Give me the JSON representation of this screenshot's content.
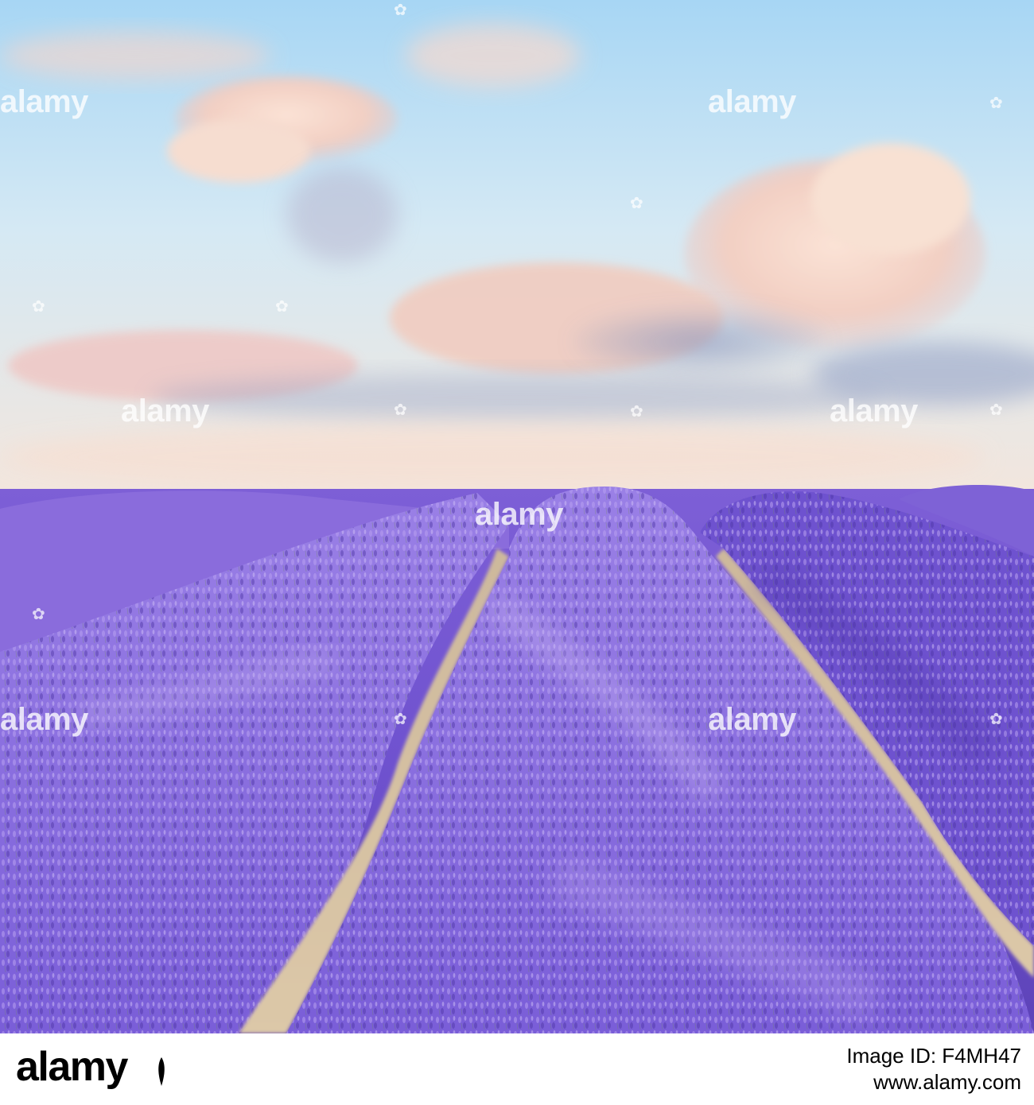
{
  "photo": {
    "subject": "Lavender field rows under a cloudy sky",
    "colors": {
      "sky_top": "#a9d7f3",
      "sky_mid": "#dcecf5",
      "sky_horizon": "#f3e8df",
      "cloud_warm": "#f5d6c8",
      "cloud_shadow": "#8d9ec4",
      "lavender_dark": "#5a3fb3",
      "lavender_mid": "#8a6ae0",
      "lavender_light": "#c3aef0",
      "soil": "#d8c3a3"
    }
  },
  "watermark": {
    "text": "alamy",
    "mark_icon": "alamy-leaf-icon"
  },
  "footer": {
    "logo": "alamy",
    "image_id": "Image ID: F4MH47",
    "site": "www.alamy.com"
  }
}
